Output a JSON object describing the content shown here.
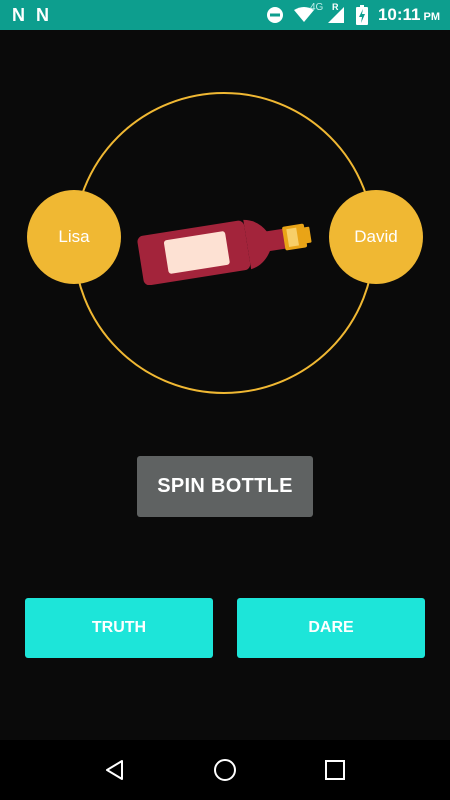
{
  "status_bar": {
    "left_icons": [
      "n-notification-icon",
      "n-notification-icon"
    ],
    "time": "10:11",
    "ampm": "PM",
    "network_label": "4G",
    "roaming_label": "R",
    "icons": [
      "do-not-disturb-icon",
      "wifi-icon",
      "signal-icon",
      "battery-charging-icon"
    ],
    "background_color": "#0d9e8e"
  },
  "game": {
    "players": [
      {
        "name": "Lisa"
      },
      {
        "name": "David"
      }
    ],
    "ring_color": "#f0b833",
    "player_color": "#f0b833",
    "bottle_color": "#a3243b",
    "label_color": "#fde1d3"
  },
  "controls": {
    "spin_label": "SPIN BOTTLE",
    "truth_label": "TRUTH",
    "dare_label": "DARE",
    "spin_color": "#5f6262",
    "action_color": "#1de5d9"
  },
  "nav_bar": {
    "buttons": [
      "back-icon",
      "home-icon",
      "recents-icon"
    ]
  }
}
